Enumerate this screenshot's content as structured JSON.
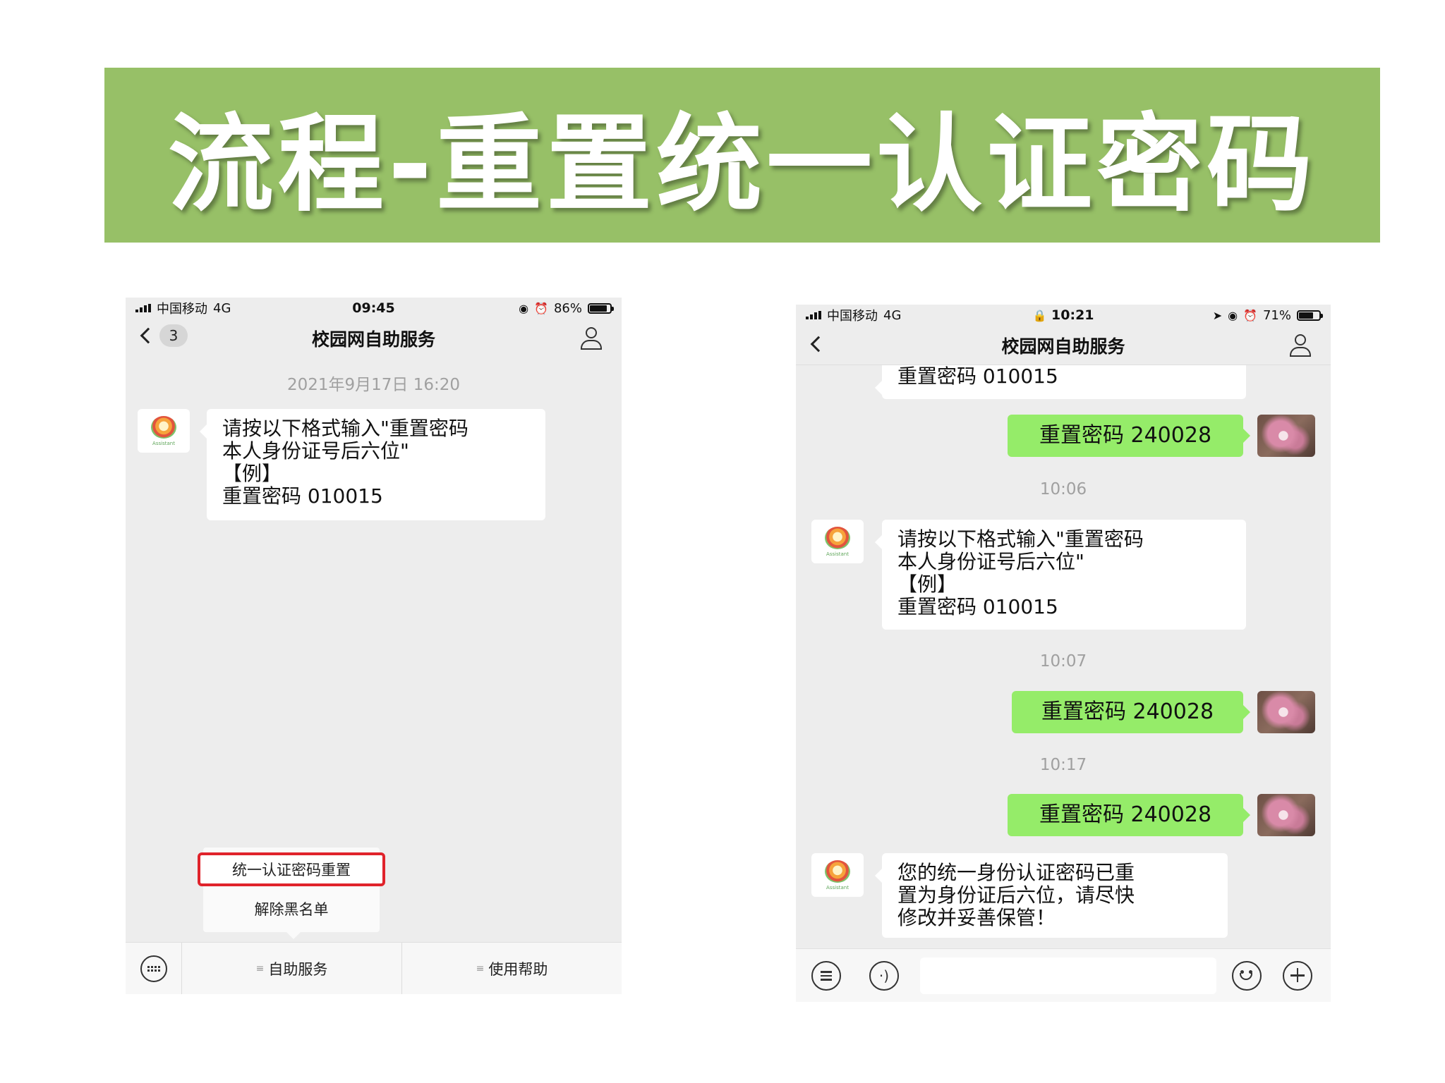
{
  "banner": {
    "title": "流程-重置统一认证密码"
  },
  "left_phone": {
    "status": {
      "carrier": "中国移动",
      "network": "4G",
      "time": "09:45",
      "battery": "86%",
      "battery_level": 0.86
    },
    "nav": {
      "title": "校园网自助服务",
      "unread_count": "3"
    },
    "timestamp": "2021年9月17日 16:20",
    "bot_avatar_label": "Assistant",
    "message": {
      "lines": [
        "请按以下格式输入\"重置密码",
        "本人身份证号后六位\"",
        "【例】",
        "重置密码 010015"
      ]
    },
    "popup_menu": {
      "items": [
        "统一认证密码重置",
        "解除黑名单"
      ]
    },
    "menubar": {
      "items": [
        "自助服务",
        "使用帮助"
      ]
    }
  },
  "right_phone": {
    "status": {
      "carrier": "中国移动",
      "network": "4G",
      "time": "10:21",
      "battery": "71%",
      "battery_level": 0.71
    },
    "nav": {
      "title": "校园网自助服务"
    },
    "bot_avatar_label": "Assistant",
    "partial_message": "重置密码 010015",
    "sent_messages": [
      "重置密码 240028",
      "重置密码 240028",
      "重置密码 240028"
    ],
    "timestamps": [
      "10:06",
      "10:07",
      "10:17"
    ],
    "message_format": {
      "lines": [
        "请按以下格式输入\"重置密码",
        "本人身份证号后六位\"",
        "【例】",
        "重置密码 010015"
      ]
    },
    "message_result": {
      "lines": [
        "您的统一身份认证密码已重",
        "置为身份证后六位，请尽快",
        "修改并妥善保管！"
      ]
    },
    "input": {
      "value": ""
    }
  },
  "colors": {
    "banner": "#97c067",
    "sent_bubble": "#95ec69",
    "highlight_border": "#e0232b",
    "chat_bg": "#ededed"
  },
  "icons": [
    "back-chevron-icon",
    "person-icon",
    "keyboard-icon",
    "menu-lines-icon",
    "voice-icon",
    "emoji-icon",
    "plus-icon"
  ]
}
